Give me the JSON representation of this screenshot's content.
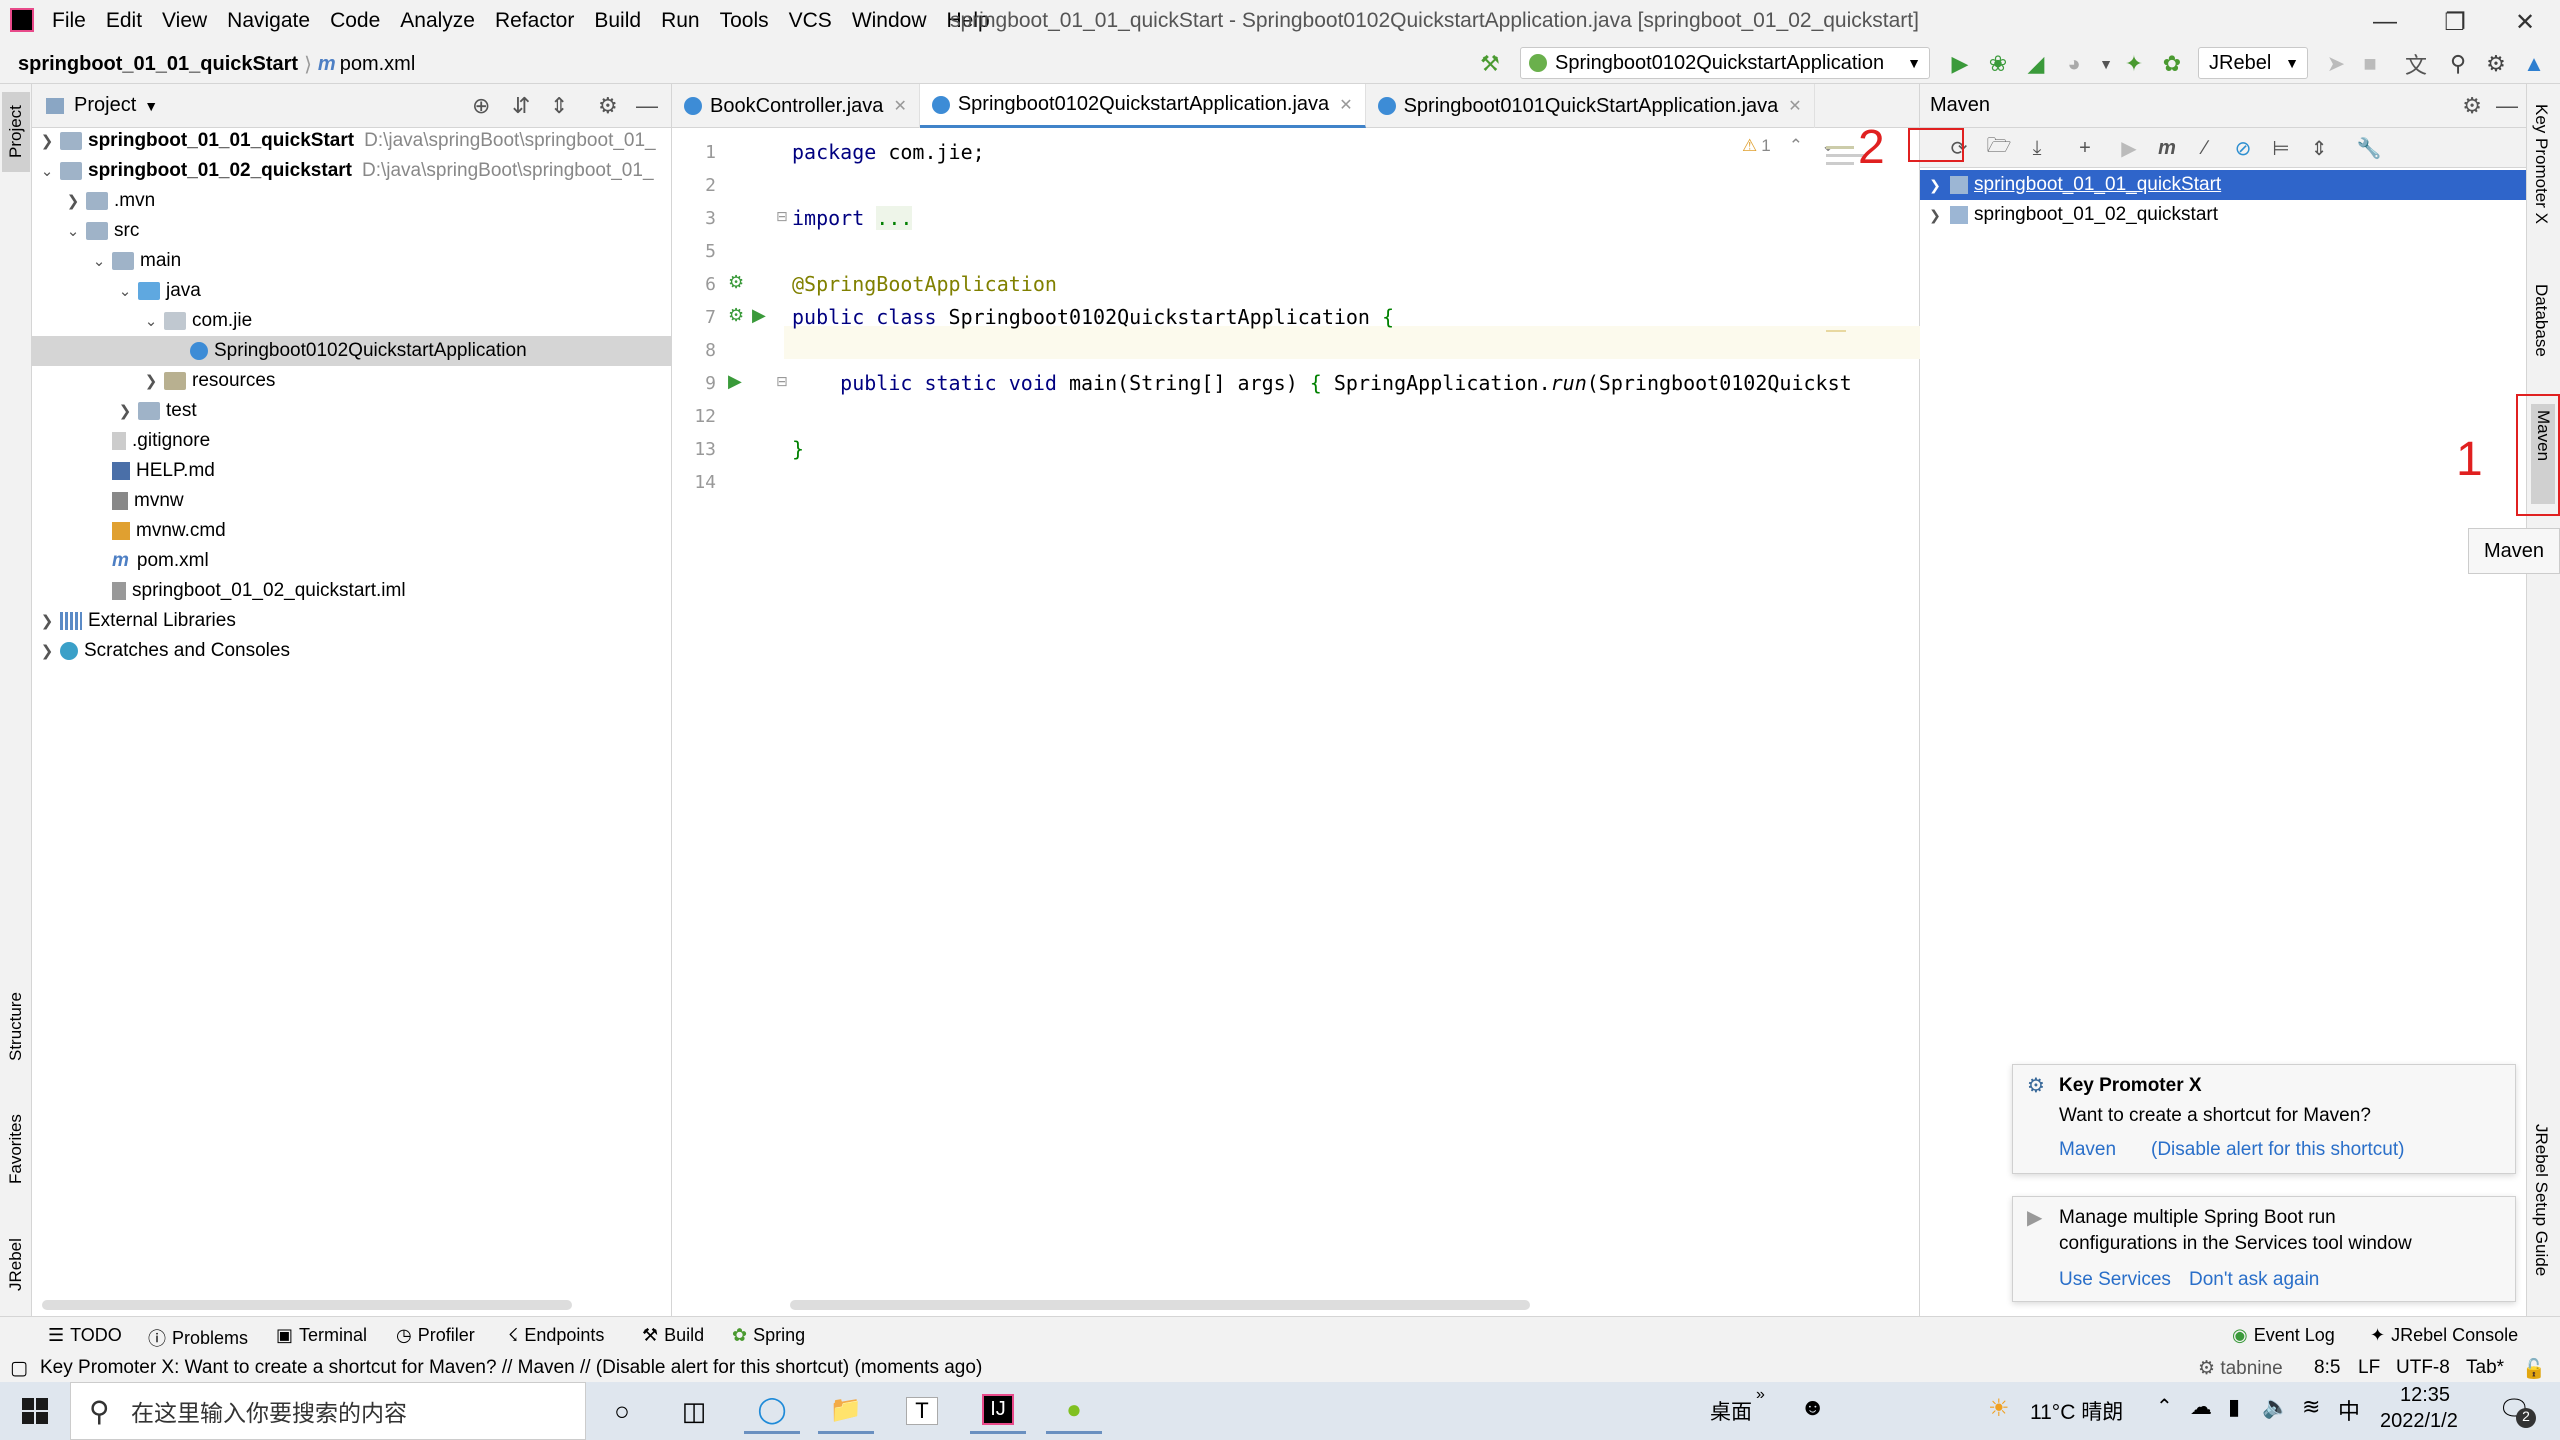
{
  "titlebar": {
    "menu": [
      "File",
      "Edit",
      "View",
      "Navigate",
      "Code",
      "Analyze",
      "Refactor",
      "Build",
      "Run",
      "Tools",
      "VCS",
      "Window",
      "Help"
    ],
    "title": "springboot_01_01_quickStart - Springboot0102QuickstartApplication.java [springboot_01_02_quickstart]"
  },
  "navbar": {
    "project": "springboot_01_01_quickStart",
    "file": "pom.xml",
    "run_config": "Springboot0102QuickstartApplication",
    "jrebel": "JRebel"
  },
  "left_strip": {
    "project": "Project",
    "structure": "Structure",
    "favorites": "Favorites",
    "jrebel": "JRebel"
  },
  "project_panel": {
    "header": "Project",
    "tree": [
      {
        "label": "springboot_01_01_quickStart",
        "path": "D:\\java\\springBoot\\springboot_01_",
        "bold": true
      },
      {
        "label": "springboot_01_02_quickstart",
        "path": "D:\\java\\springBoot\\springboot_01_",
        "bold": true
      },
      {
        "label": ".mvn"
      },
      {
        "label": "src"
      },
      {
        "label": "main"
      },
      {
        "label": "java"
      },
      {
        "label": "com.jie"
      },
      {
        "label": "Springboot0102QuickstartApplication"
      },
      {
        "label": "resources"
      },
      {
        "label": "test"
      },
      {
        "label": ".gitignore"
      },
      {
        "label": "HELP.md"
      },
      {
        "label": "mvnw"
      },
      {
        "label": "mvnw.cmd"
      },
      {
        "label": "pom.xml"
      },
      {
        "label": "springboot_01_02_quickstart.iml"
      },
      {
        "label": "External Libraries"
      },
      {
        "label": "Scratches and Consoles"
      }
    ]
  },
  "editor": {
    "tabs": [
      "BookController.java",
      "Springboot0102QuickstartApplication.java",
      "Springboot0101QuickStartApplication.java"
    ],
    "warning_count": "1",
    "lines": [
      {
        "n": "1",
        "text": "package com.jie;"
      },
      {
        "n": "2",
        "text": ""
      },
      {
        "n": "3",
        "text": "import ..."
      },
      {
        "n": "5",
        "text": ""
      },
      {
        "n": "6",
        "text": "@SpringBootApplication"
      },
      {
        "n": "7",
        "text": "public class Springboot0102QuickstartApplication {"
      },
      {
        "n": "8",
        "text": ""
      },
      {
        "n": "9",
        "text": "    public static void main(String[] args) { SpringApplication.run(Springboot0102Quickst"
      },
      {
        "n": "12",
        "text": ""
      },
      {
        "n": "13",
        "text": "}"
      },
      {
        "n": "14",
        "text": ""
      }
    ]
  },
  "maven": {
    "header": "Maven",
    "projects": [
      "springboot_01_01_quickStart",
      "springboot_01_02_quickstart"
    ],
    "tooltip": "Maven"
  },
  "right_strip": {
    "key_promoter": "Key Promoter X",
    "database": "Database",
    "maven": "Maven",
    "jrebel_setup": "JRebel Setup Guide"
  },
  "annotations": {
    "one": "1",
    "two": "2"
  },
  "notifications": {
    "key_promoter": {
      "title": "Key Promoter X",
      "body": "Want to create a shortcut for Maven?",
      "link1": "Maven",
      "link2": "(Disable alert for this shortcut)"
    },
    "spring": {
      "body1": "Manage multiple Spring Boot run",
      "body2": "configurations in the Services tool window",
      "link1": "Use Services",
      "link2": "Don't ask again"
    }
  },
  "toolwindows": [
    "TODO",
    "Problems",
    "Terminal",
    "Profiler",
    "Endpoints",
    "Build",
    "Spring"
  ],
  "toolwindows_right": [
    "Event Log",
    "JRebel Console"
  ],
  "status": {
    "message": "Key Promoter X: Want to create a shortcut for Maven? // Maven // (Disable alert for this shortcut) (moments ago)",
    "tabnine": "tabnine",
    "position": "8:5",
    "line_sep": "LF",
    "encoding": "UTF-8",
    "indent": "Tab*"
  },
  "taskbar": {
    "search_placeholder": "在这里输入你要搜索的内容",
    "desktop": "桌面",
    "weather": "11°C 晴朗",
    "ime": "中",
    "time": "12:35",
    "date": "2022/1/2",
    "notif_count": "2"
  },
  "colors": {
    "accent": "#2f65ca",
    "annotation": "#e02020"
  }
}
